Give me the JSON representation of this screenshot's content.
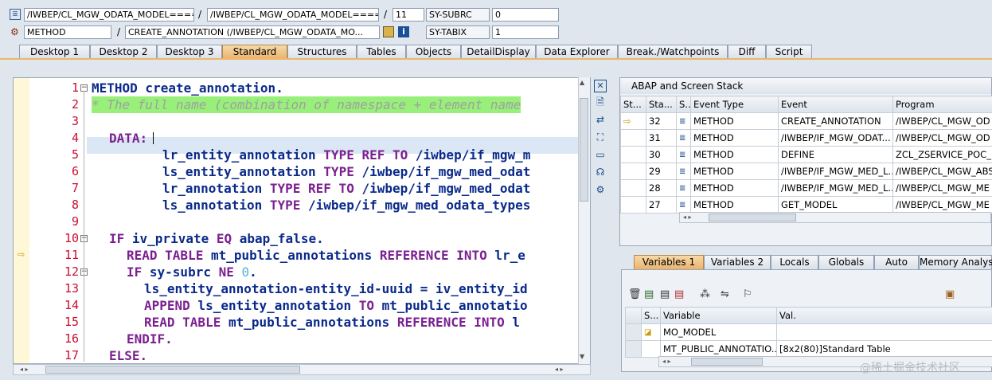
{
  "header": {
    "row1": {
      "program1": "/IWBEP/CL_MGW_ODATA_MODEL=====...",
      "program2": "/IWBEP/CL_MGW_ODATA_MODEL=====...",
      "line": "11",
      "var_name": "SY-SUBRC",
      "var_value": "0"
    },
    "row2": {
      "type": "METHOD",
      "event": "CREATE_ANNOTATION (/IWBEP/CL_MGW_ODATA_MO...",
      "var_name": "SY-TABIX",
      "var_value": "1"
    }
  },
  "tabs": [
    "Desktop 1",
    "Desktop 2",
    "Desktop 3",
    "Standard",
    "Structures",
    "Tables",
    "Objects",
    "DetailDisplay",
    "Data Explorer",
    "Break./Watchpoints",
    "Diff",
    "Script"
  ],
  "active_tab": "Standard",
  "code_lines": [
    {
      "n": "1"
    },
    {
      "n": "2"
    },
    {
      "n": "3"
    },
    {
      "n": "4"
    },
    {
      "n": "5"
    },
    {
      "n": "6"
    },
    {
      "n": "7"
    },
    {
      "n": "8"
    },
    {
      "n": "9"
    },
    {
      "n": "10"
    },
    {
      "n": "11"
    },
    {
      "n": "12"
    },
    {
      "n": "13"
    },
    {
      "n": "14"
    },
    {
      "n": "15"
    },
    {
      "n": "16"
    },
    {
      "n": "17"
    }
  ],
  "code": {
    "l1a": "METHOD",
    "l1b": " create_annotation.",
    "l2": "* The full name (combination of namespace + element name",
    "l4": "DATA:",
    "l5a": "lr_entity_annotation ",
    "l5b": "TYPE REF TO",
    "l5c": " /iwbep/if_mgw_m",
    "l6a": "ls_entity_annotation ",
    "l6b": "TYPE",
    "l6c": " /iwbep/if_mgw_med_odat",
    "l7a": "lr_annotation ",
    "l7b": "TYPE REF TO",
    "l7c": " /iwbep/if_mgw_med_odat",
    "l8a": "ls_annotation ",
    "l8b": "TYPE",
    "l8c": " /iwbep/if_mgw_med_odata_types",
    "l10a": "IF",
    "l10b": " iv_private ",
    "l10c": "EQ",
    "l10d": " abap_false.",
    "l11a": "READ TABLE",
    "l11b": " mt_public_annotations ",
    "l11c": "REFERENCE INTO",
    "l11d": " lr_e",
    "l12a": "IF",
    "l12b": " sy-subrc ",
    "l12c": "NE",
    "l12d": " 0",
    "l12e": ".",
    "l13": "ls_entity_annotation-entity_id-uuid = iv_entity_id",
    "l14a": "APPEND",
    "l14b": " ls_entity_annotation ",
    "l14c": "TO",
    "l14d": " mt_public_annotatio",
    "l15a": "READ TABLE",
    "l15b": " mt_public_annotations ",
    "l15c": "REFERENCE INTO",
    "l15d": " l",
    "l16": "ENDIF.",
    "l17": "ELSE."
  },
  "stack": {
    "title": "ABAP and Screen Stack",
    "columns": [
      "St...",
      "Sta...",
      "S..",
      "Event Type",
      "Event",
      "Program"
    ],
    "rows": [
      {
        "sta": "32",
        "etype": "METHOD",
        "event": "CREATE_ANNOTATION",
        "program": "/IWBEP/CL_MGW_OD"
      },
      {
        "sta": "31",
        "etype": "METHOD",
        "event": "/IWBEP/IF_MGW_ODAT...",
        "program": "/IWBEP/CL_MGW_OD"
      },
      {
        "sta": "30",
        "etype": "METHOD",
        "event": "DEFINE",
        "program": "ZCL_ZSERVICE_POC_I"
      },
      {
        "sta": "29",
        "etype": "METHOD",
        "event": "/IWBEP/IF_MGW_MED_L...",
        "program": "/IWBEP/CL_MGW_ABS"
      },
      {
        "sta": "28",
        "etype": "METHOD",
        "event": "/IWBEP/IF_MGW_MED_L...",
        "program": "/IWBEP/CL_MGW_ME"
      },
      {
        "sta": "27",
        "etype": "METHOD",
        "event": "GET_MODEL",
        "program": "/IWBEP/CL_MGW_ME"
      }
    ]
  },
  "var_tabs": [
    "Variables 1",
    "Variables 2",
    "Locals",
    "Globals",
    "Auto",
    "Memory Analysis"
  ],
  "variables": {
    "columns": [
      "S...",
      "Variable",
      "Val."
    ],
    "rows": [
      {
        "variable": "MO_MODEL",
        "value": ""
      },
      {
        "variable": "MT_PUBLIC_ANNOTATIO...",
        "value": "[8x2(80)]Standard Table"
      }
    ]
  },
  "watermark": "@稀土掘金技术社区"
}
